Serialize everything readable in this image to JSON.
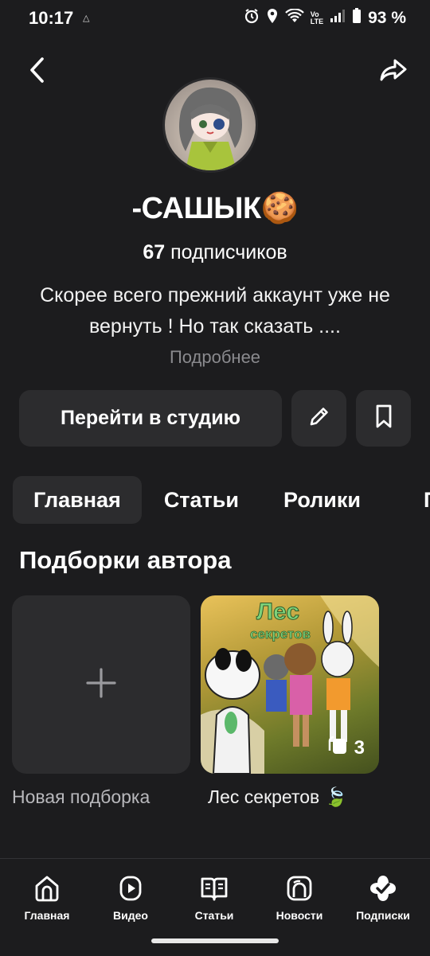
{
  "status": {
    "time": "10:17",
    "battery": "93 %"
  },
  "profile": {
    "name": "-САШЫК🍪",
    "subscribers_count": "67",
    "subscribers_label": "подписчиков",
    "description": "Скорее всего прежний аккаунт уже не вернуть ! Но так сказать ....",
    "more_label": "Подробнее"
  },
  "actions": {
    "studio_label": "Перейти в студию"
  },
  "tabs": [
    {
      "label": "Главная",
      "active": true
    },
    {
      "label": "Статьи",
      "active": false
    },
    {
      "label": "Ролики",
      "active": false
    }
  ],
  "section": {
    "title": "Подборки автора",
    "new_collection_label": "Новая подборка",
    "collection": {
      "label": "Лес секретов 🍃",
      "count": "3",
      "cover_text": "Лес секретов"
    }
  },
  "bottom_nav": [
    {
      "label": "Главная",
      "icon": "home-icon"
    },
    {
      "label": "Видео",
      "icon": "play-icon"
    },
    {
      "label": "Статьи",
      "icon": "book-icon"
    },
    {
      "label": "Новости",
      "icon": "news-icon"
    },
    {
      "label": "Подписки",
      "icon": "subscriptions-icon"
    }
  ],
  "colors": {
    "background": "#1c1c1e",
    "card": "#2c2c2e",
    "muted_text": "#8a8a8e"
  }
}
